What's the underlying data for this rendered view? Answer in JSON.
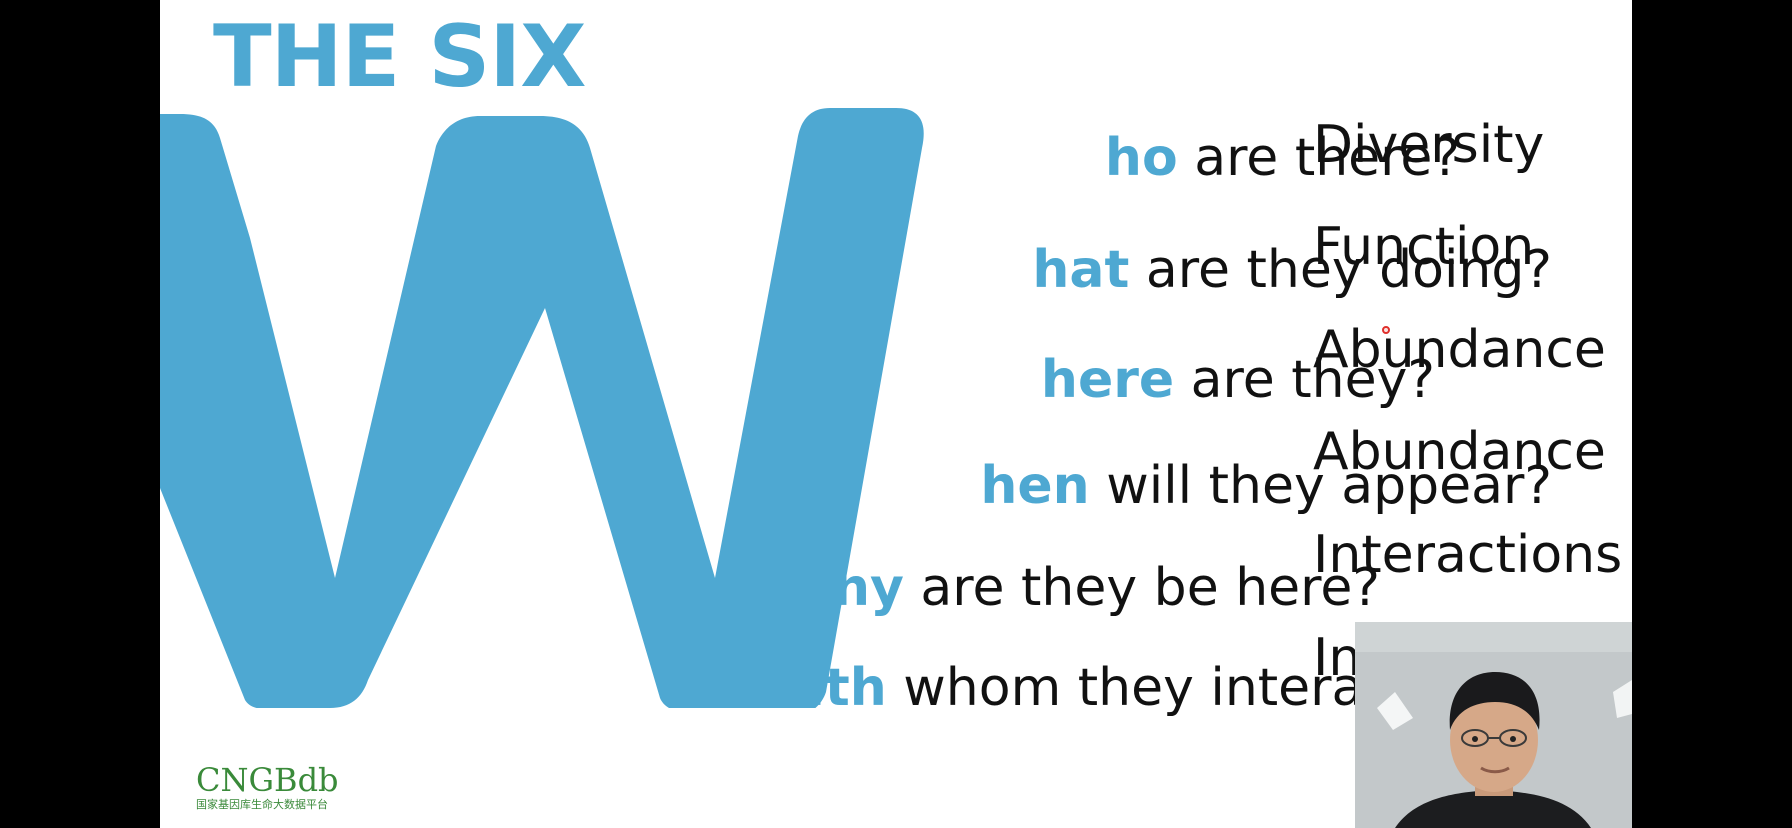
{
  "slide": {
    "title": "THE SIX",
    "big_letter": "W",
    "accent_color": "#4ea8d2",
    "rows": [
      {
        "prefix": "ho",
        "rest": " are there?",
        "answer": "Diversity"
      },
      {
        "prefix": "hat",
        "rest": " are they doing?",
        "answer": "Function"
      },
      {
        "prefix": "here",
        "rest": " are they?",
        "answer": "Abundance"
      },
      {
        "prefix": "hen",
        "rest": " will they appear?",
        "answer": "Abundance"
      },
      {
        "prefix": "hy",
        "rest": " are they be here?",
        "answer": "Interactions"
      },
      {
        "prefix": "ith",
        "rest": " whom they interact?",
        "answer": "In"
      }
    ],
    "logo": {
      "main": "CNGBdb",
      "sub": "国家基因库生命大数据平台",
      "color": "#3a8a3a"
    }
  },
  "webcam": {
    "icon": "presenter-webcam"
  }
}
